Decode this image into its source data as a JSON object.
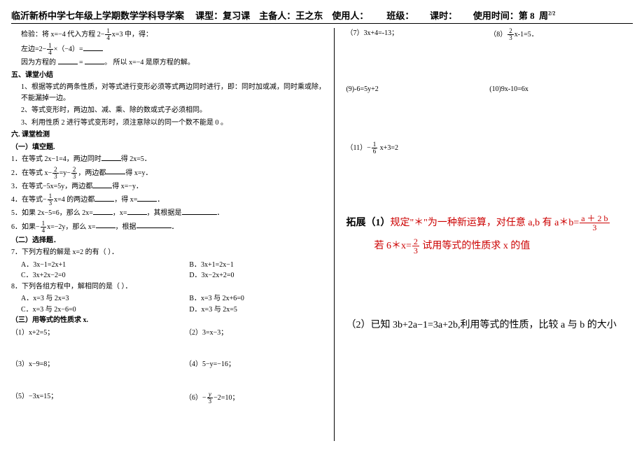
{
  "header": {
    "school": "临沂新桥中学七年级上学期数学学科导学案",
    "type_label": "课型：",
    "type_value": "复习课",
    "organizer_label": "主备人：",
    "organizer_value": "王之东",
    "user_label": "使用人：",
    "class_label": "班级：",
    "period_label": "课时：",
    "usetime_label": "使用时间：第",
    "week_value": "8",
    "week_suffix": "周",
    "page_sup": "2/2"
  },
  "left": {
    "check_a": "检验：将 x=−4 代入方程 2−",
    "check_b": "x=3 中，得：",
    "leftside_a": "左边=2−",
    "leftside_b": "×（−4）=",
    "because_a": "因为方程的",
    "because_b": "=",
    "because_c": "。 所以 x=−4 是原方程的解。",
    "sec5_title": "五、课堂小结",
    "sec5_1": "1、根据等式的两条性质，对等式进行变形必须等式两边同时进行，即：同时加或减，同时乘或除，不能漏掉一边。",
    "sec5_2": "2、等式变形时，两边加、减、乘、除的数或式子必须相同。",
    "sec5_3": "3、利用性质 2 进行等式变形时，须注意除以的同一个数不能是 0 。",
    "sec6_title": "六. 课堂检测",
    "fill_title": "（一）填空题.",
    "f1_a": "1．在等式 2x−1=4，两边同时",
    "f1_b": "得 2x=5．",
    "f2_a": "2．在等式 x−",
    "f2_b": "=y−",
    "f2_c": "，两边都",
    "f2_d": "得 x=y．",
    "f3_a": "3．在等式−5x=5y，两边都",
    "f3_b": "得 x=−y．",
    "f4_a": "4．在等式−",
    "f4_b": "x=4 的两边都",
    "f4_c": "，得 x=",
    "f4_d": "．",
    "f5_a": "5．如果 2x−5=6，那么 2x=",
    "f5_b": "，x=",
    "f5_c": "，其根据是",
    "f5_d": "．",
    "f6_a": "6．如果−",
    "f6_b": "x=−2y，那么 x=",
    "f6_c": "，根据",
    "f6_d": "．",
    "choice_title": "（二）选择题．",
    "c7": "7．下列方程的解是 x=2 的有（  ）．",
    "c7a": "A．3x−1=2x+1",
    "c7b": "B．3x+1=2x−1",
    "c7c": "C．3x+2x−2=0",
    "c7d": "D．3x−2x+2=0",
    "c8": "8．下列各组方程中，解相同的是（  ）．",
    "c8a": "A．x=3 与 2x=3",
    "c8b": "B．x=3 与 2x+6=0",
    "c8c": "C．x=3 与 2x−6=0",
    "c8d": "D．x=3 与 2x=5",
    "prop_title": "（三）用等式的性质求 x.",
    "p1": "（1）x+2=5；",
    "p2": "（2）3=x−3；",
    "p3": "（3）x−9=8；",
    "p4": "（4）5−y=−16；",
    "p5": "（5）−3x=15；",
    "p6a": "（6）−",
    "p6b": "−2=10；"
  },
  "right": {
    "r7": "（7）3x+4=-13；",
    "r8a": "（8）",
    "r8b": "x-1=5．",
    "r9": "(9)-6=5y+2",
    "r10": "(10)9x-10=6x",
    "r11a": "（11）−",
    "r11b": "x+3=2",
    "ext_label": "拓展（1）",
    "ext_a": "规定\"＊\"为一种新运算，对任意 a,b 有 a＊b=",
    "ext_frac_num": "a ＋ 2 b",
    "ext_frac_den": "3",
    "ext_b": "若 6＊x=",
    "ext_c": " 试用等式的性质求 x 的值",
    "q2": "（2）已知 3b+2a−1=3a+2b,利用等式的性质，比较 a 与 b 的大小"
  }
}
